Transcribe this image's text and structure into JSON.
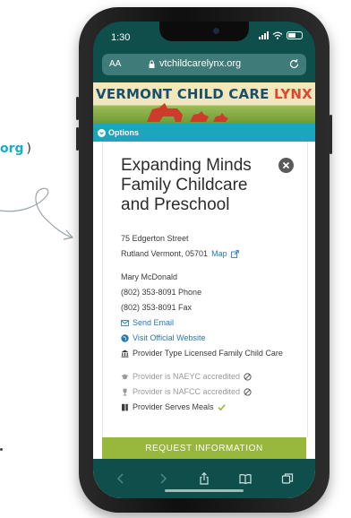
{
  "side_text": {
    "url_fragment": "org",
    "paren": ")"
  },
  "status": {
    "time": "1:30"
  },
  "browser": {
    "text_size_label": "AA",
    "url": "vtchildcarelynx.org"
  },
  "banner": {
    "title_main": "VERMONT CHILD CARE ",
    "title_accent": "LYNX"
  },
  "options": {
    "label": "Options"
  },
  "provider": {
    "name": "Expanding Minds Family Childcare and Preschool",
    "street": "75 Edgerton Street",
    "city": "Rutland Vermont, 05701",
    "map_label": "Map",
    "contact": "Mary McDonald",
    "phone": "(802) 353-8091 Phone",
    "fax": "(802) 353-8091 Fax",
    "email_label": "Send Email",
    "website_label": "Visit Official Website",
    "type": "Provider Type Licensed Family Child Care",
    "naeyc": "Provider is NAEYC accredited",
    "nafcc": "Provider is NAFCC accredited",
    "meals": "Provider Serves Meals"
  },
  "request_button": {
    "label": "REQUEST INFORMATION"
  },
  "colors": {
    "teal_dark": "#0e4f4c",
    "accent_cyan": "#1ca6bb",
    "green": "#97b83c",
    "link": "#2878b5"
  }
}
